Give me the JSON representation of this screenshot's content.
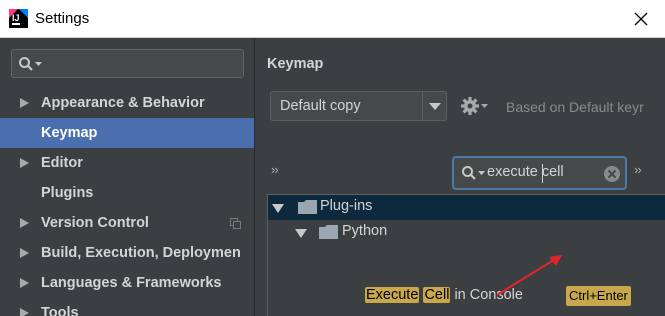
{
  "window": {
    "title": "Settings",
    "icon": "intellij-idea-icon",
    "close_icon": "close-icon"
  },
  "sidebar": {
    "search_placeholder": "",
    "items": [
      {
        "label": "Appearance & Behavior",
        "expandable": true,
        "selected": false
      },
      {
        "label": "Keymap",
        "expandable": false,
        "selected": true
      },
      {
        "label": "Editor",
        "expandable": true,
        "selected": false
      },
      {
        "label": "Plugins",
        "expandable": false,
        "selected": false
      },
      {
        "label": "Version Control",
        "expandable": true,
        "selected": false,
        "project_icon": "copy-icon"
      },
      {
        "label": "Build, Execution, Deploymen",
        "expandable": true,
        "selected": false
      },
      {
        "label": "Languages & Frameworks",
        "expandable": true,
        "selected": false
      },
      {
        "label": "Tools",
        "expandable": true,
        "selected": false
      }
    ]
  },
  "main": {
    "title": "Keymap",
    "keymap_select": {
      "value": "Default copy"
    },
    "based_on": "Based on Default keyr",
    "filter": {
      "value_before_caret": "execute ",
      "value_after_caret": "cell"
    },
    "tree": {
      "root": {
        "label": "Plug-ins",
        "expanded": true
      },
      "child": {
        "label": "Python",
        "expanded": true
      },
      "action": {
        "word1": "Execute",
        "word2": "Cell",
        "rest": " in Console",
        "shortcut": "Ctrl+Enter"
      }
    }
  },
  "colors": {
    "selection": "#4b6eaf",
    "highlight": "#c9a84c",
    "annotation_arrow": "#e0262b"
  }
}
